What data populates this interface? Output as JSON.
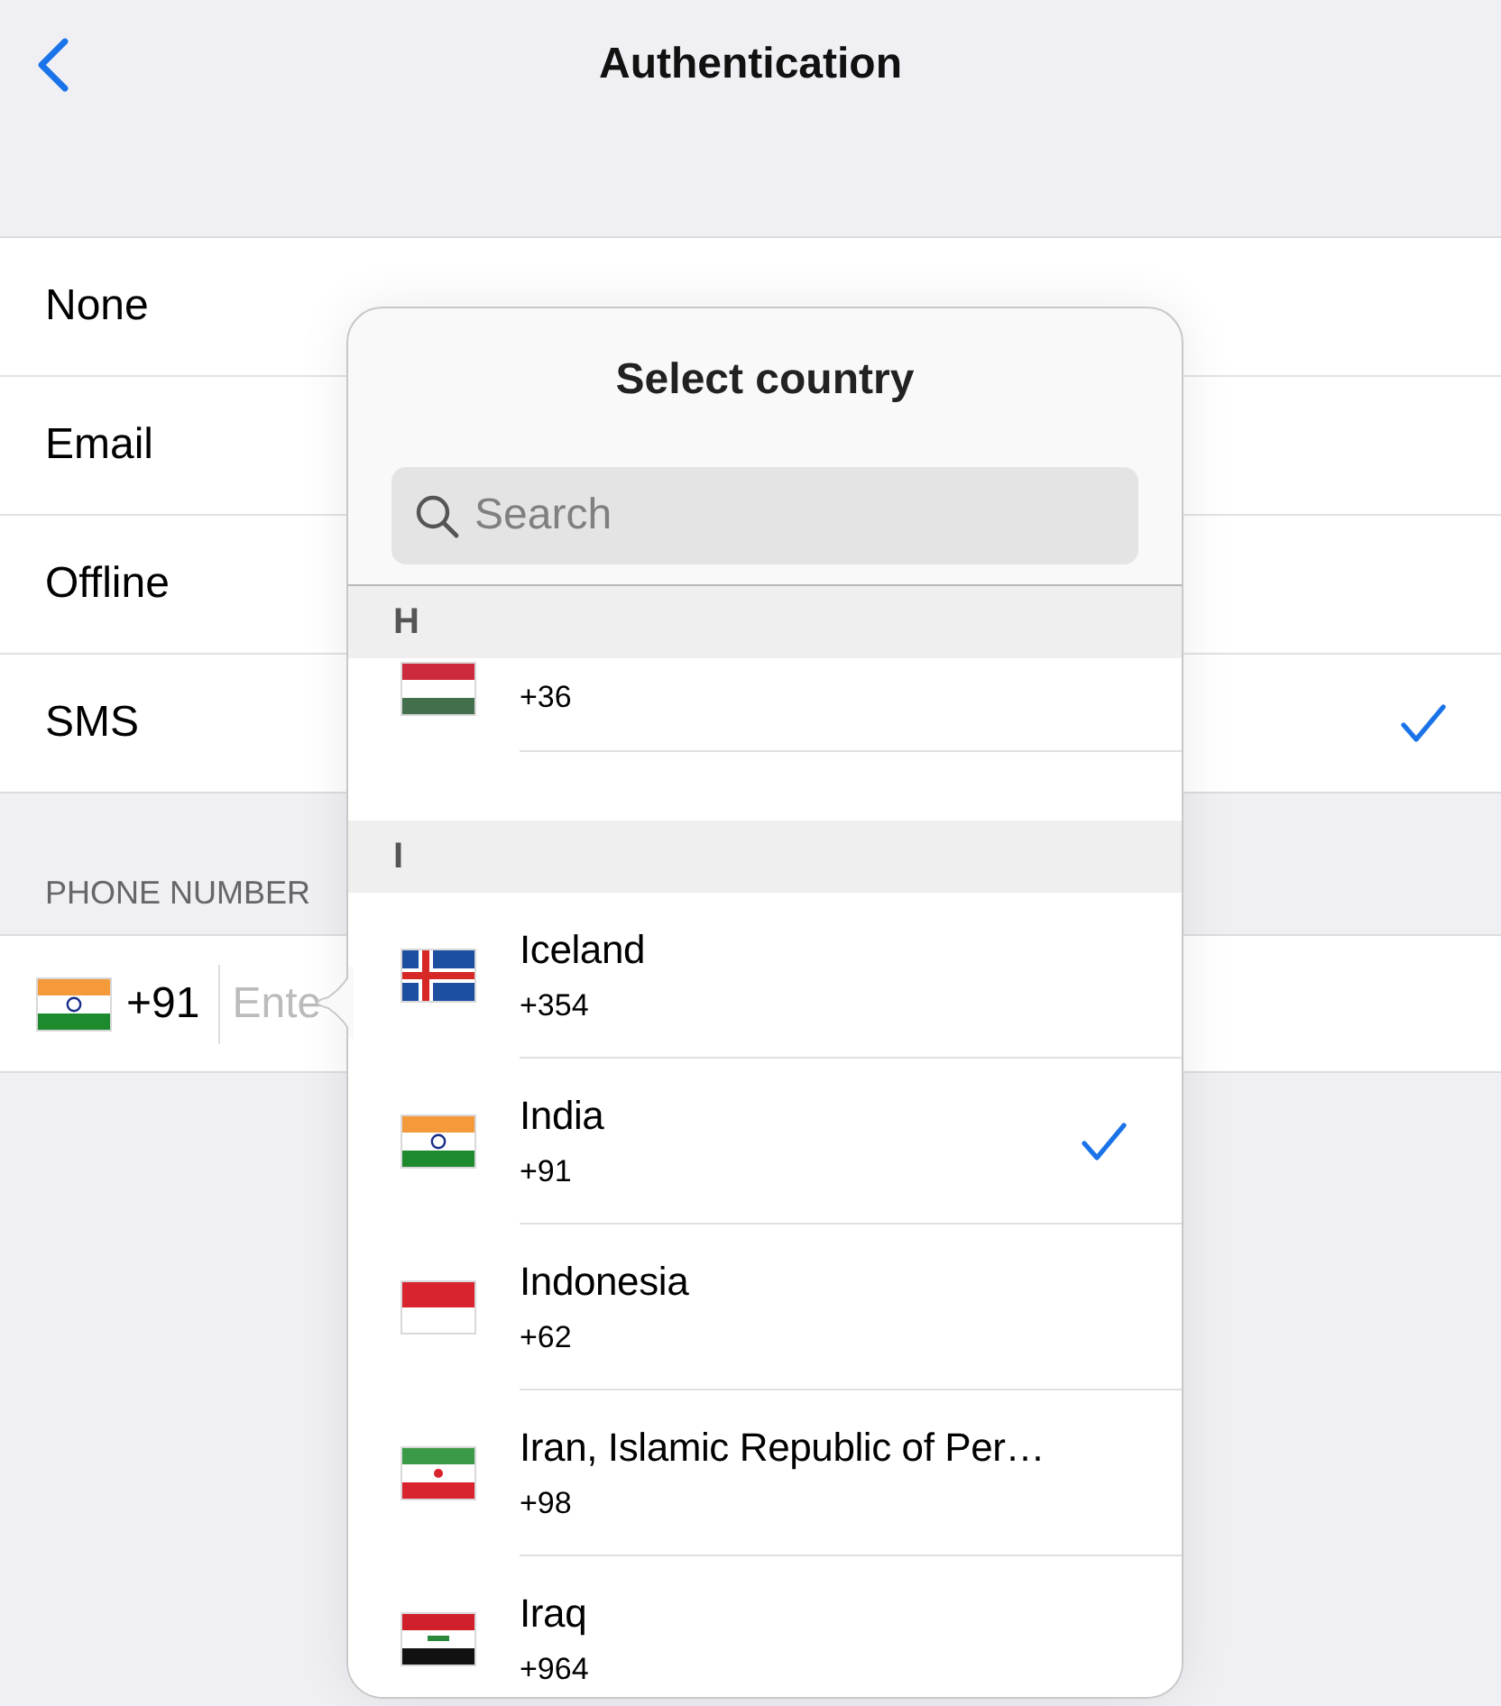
{
  "title": "Authentication",
  "methods": [
    {
      "label": "None",
      "selected": false
    },
    {
      "label": "Email",
      "selected": false
    },
    {
      "label": "Offline",
      "selected": false
    },
    {
      "label": "SMS",
      "selected": true
    }
  ],
  "phone": {
    "section": "PHONE NUMBER",
    "code": "+91",
    "placeholder": "Ente"
  },
  "popover": {
    "title": "Select country",
    "search": {
      "placeholder": "Search"
    },
    "sections": [
      {
        "letter": "H",
        "countries": [
          {
            "code": "+36",
            "selected": false
          }
        ]
      },
      {
        "letter": "I",
        "countries": [
          {
            "name": "Iceland",
            "code": "+354",
            "selected": false
          },
          {
            "name": "India",
            "code": "+91",
            "selected": true
          },
          {
            "name": "Indonesia",
            "code": "+62",
            "selected": false
          },
          {
            "name": "Iran, Islamic Republic of Per…",
            "code": "+98",
            "selected": false
          },
          {
            "name": "Iraq",
            "code": "+964",
            "selected": false
          }
        ]
      }
    ]
  }
}
